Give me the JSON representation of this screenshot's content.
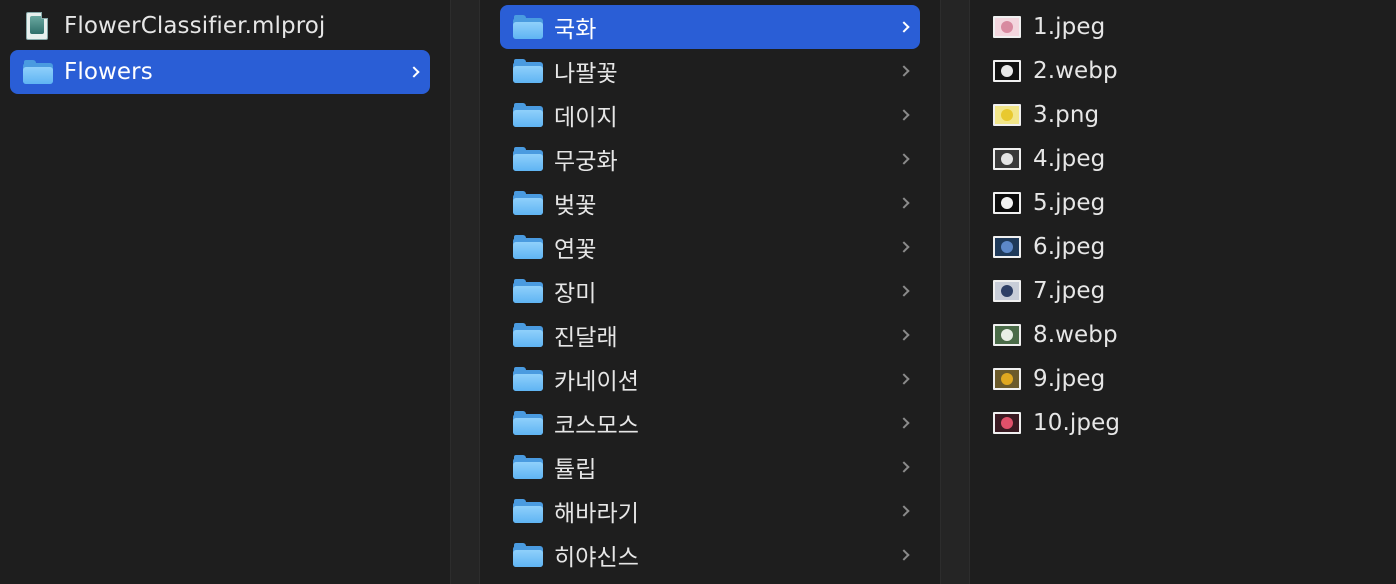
{
  "columns": {
    "root": {
      "items": [
        {
          "label": "FlowerClassifier.mlproj",
          "icon": "mlproj-file-icon"
        },
        {
          "label": "Flowers",
          "icon": "folder-icon"
        }
      ]
    },
    "folders": {
      "items": [
        {
          "label": "국화"
        },
        {
          "label": "나팔꽃"
        },
        {
          "label": "데이지"
        },
        {
          "label": "무궁화"
        },
        {
          "label": "벚꽃"
        },
        {
          "label": "연꽃"
        },
        {
          "label": "장미"
        },
        {
          "label": "진달래"
        },
        {
          "label": "카네이션"
        },
        {
          "label": "코스모스"
        },
        {
          "label": "튤립"
        },
        {
          "label": "해바라기"
        },
        {
          "label": "히야신스"
        }
      ]
    },
    "files": {
      "items": [
        {
          "label": "1.jpeg",
          "thumb_color": "#d88aa0",
          "thumb_bg": "#f3d6de"
        },
        {
          "label": "2.webp",
          "thumb_color": "#e8e8e8",
          "thumb_bg": "#111111"
        },
        {
          "label": "3.png",
          "thumb_color": "#e8c930",
          "thumb_bg": "#f2e68a"
        },
        {
          "label": "4.jpeg",
          "thumb_color": "#e6e6e6",
          "thumb_bg": "#3a3a3a"
        },
        {
          "label": "5.jpeg",
          "thumb_color": "#f2f2f2",
          "thumb_bg": "#0b0b0b"
        },
        {
          "label": "6.jpeg",
          "thumb_color": "#5d88c8",
          "thumb_bg": "#1f3a5a"
        },
        {
          "label": "7.jpeg",
          "thumb_color": "#2e3f66",
          "thumb_bg": "#c8cdd8"
        },
        {
          "label": "8.webp",
          "thumb_color": "#e8efe6",
          "thumb_bg": "#4a6b48"
        },
        {
          "label": "9.jpeg",
          "thumb_color": "#e0a820",
          "thumb_bg": "#6b5a2a"
        },
        {
          "label": "10.jpeg",
          "thumb_color": "#e0506a",
          "thumb_bg": "#3a1a22"
        }
      ]
    }
  },
  "colors": {
    "selection": "#2a5ed6",
    "background": "#1e1e1e",
    "folder_blue": "#5fb4f3"
  }
}
